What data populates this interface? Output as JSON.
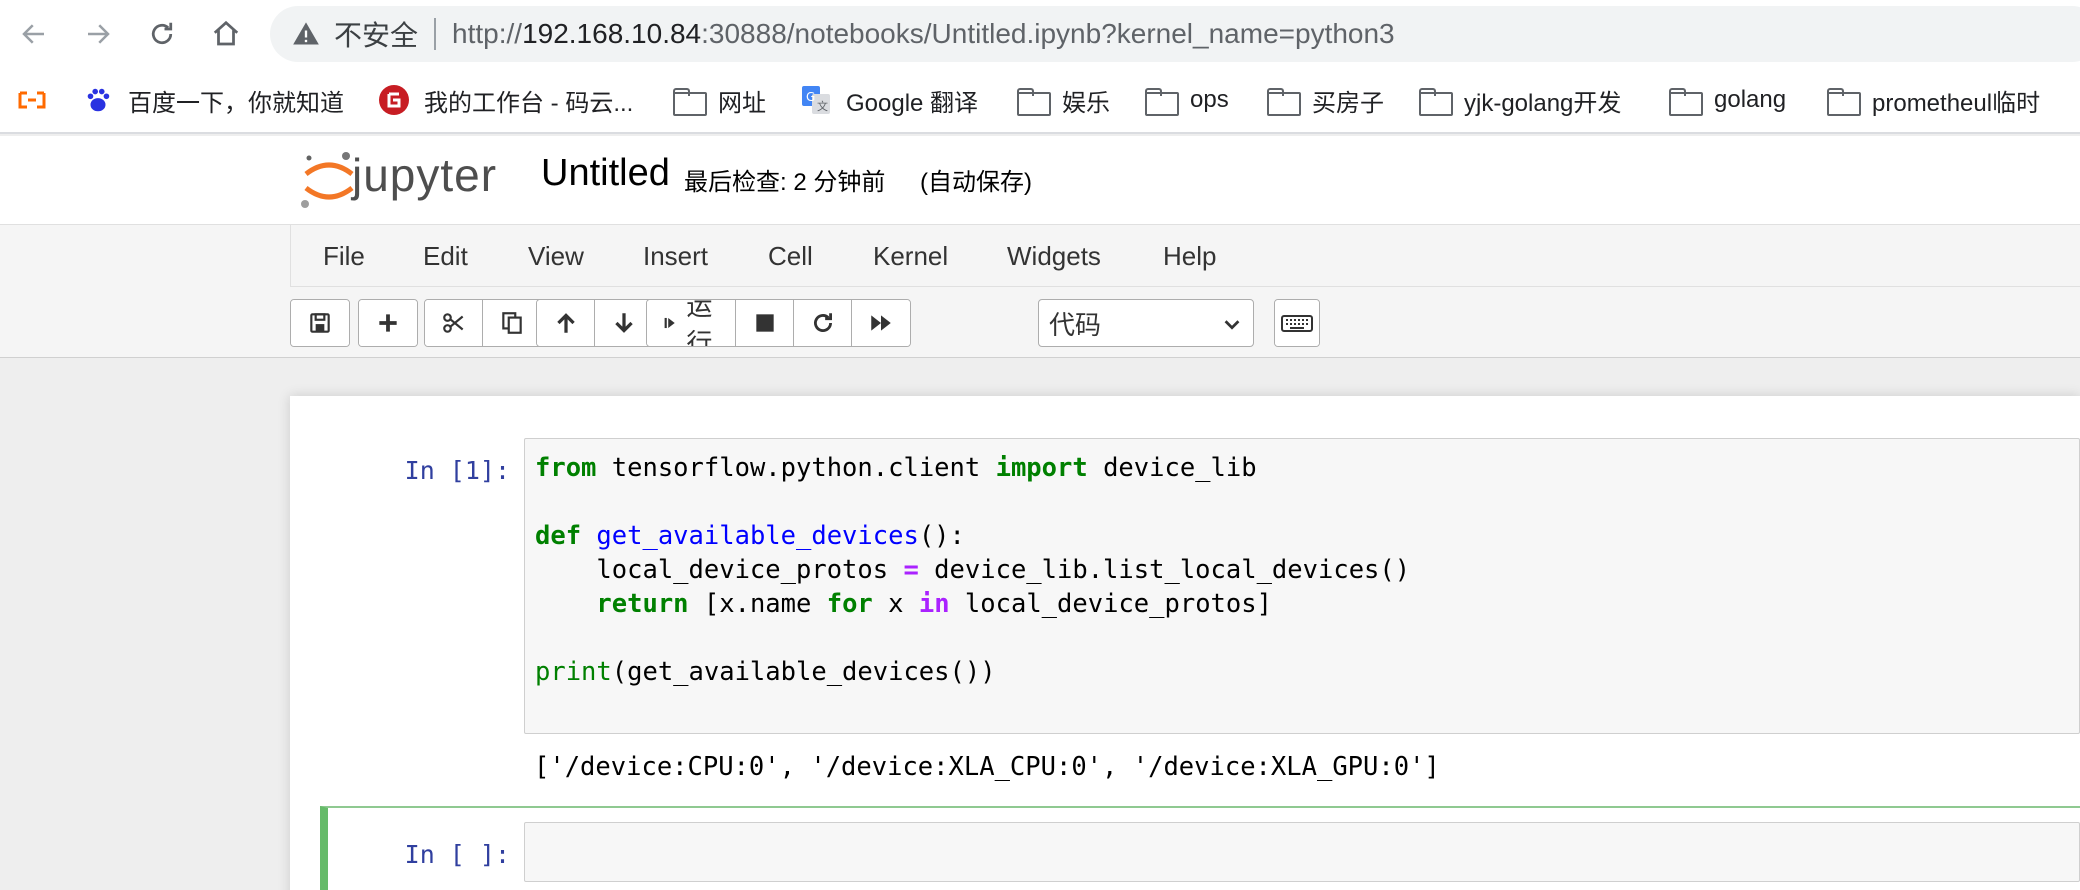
{
  "browser": {
    "url_insecure_label": "不安全",
    "url_host": "192.168.10.84",
    "url_scheme": "http://",
    "url_rest": ":30888/notebooks/Untitled.ipynb?kernel_name=python3",
    "bookmarks": [
      {
        "label": "百度一下，你就知道",
        "icon": "baidu-icon"
      },
      {
        "label": "我的工作台 - 码云...",
        "icon": "gitee-icon"
      },
      {
        "label": "网址",
        "icon": "folder-icon"
      },
      {
        "label": "Google 翻译",
        "icon": "google-translate-icon"
      },
      {
        "label": "娱乐",
        "icon": "folder-icon"
      },
      {
        "label": "ops",
        "icon": "folder-icon"
      },
      {
        "label": "买房子",
        "icon": "folder-icon"
      },
      {
        "label": "yjk-golang开发",
        "icon": "folder-icon"
      },
      {
        "label": "golang",
        "icon": "folder-icon"
      },
      {
        "label": "prometheul临时",
        "icon": "folder-icon"
      }
    ]
  },
  "jupyter": {
    "wordmark": "jupyter",
    "notebook_title": "Untitled",
    "checkpoint": "最后检查: 2 分钟前",
    "autosave": "(自动保存)",
    "menu": [
      "File",
      "Edit",
      "View",
      "Insert",
      "Cell",
      "Kernel",
      "Widgets",
      "Help"
    ],
    "toolbar": {
      "run_label": "运行",
      "cell_type": "代码"
    },
    "accent_color": "#f37726"
  },
  "cells": [
    {
      "prompt": "In [1]:",
      "code_lines": [
        "from tensorflow.python.client import device_lib",
        "",
        "def get_available_devices():",
        "    local_device_protos = device_lib.list_local_devices()",
        "    return [x.name for x in local_device_protos]",
        "",
        "print(get_available_devices())"
      ],
      "output": "['/device:CPU:0', '/device:XLA_CPU:0', '/device:XLA_GPU:0']"
    },
    {
      "prompt": "In [ ]:",
      "code_lines": [],
      "output": ""
    }
  ]
}
